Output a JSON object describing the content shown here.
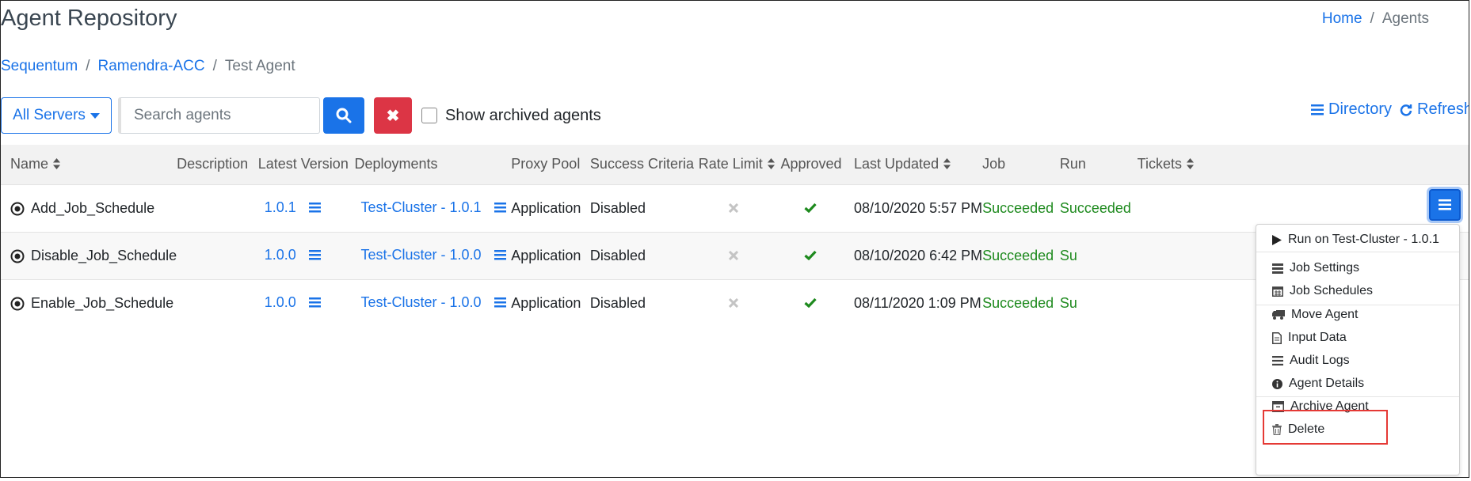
{
  "page": {
    "title": "Agent Repository",
    "top_breadcrumb": {
      "home": "Home",
      "current": "Agents",
      "separator": "/"
    }
  },
  "breadcrumb": {
    "items": [
      "Sequentum",
      "Ramendra-ACC",
      "Test Agent"
    ],
    "separator": "/"
  },
  "toolbar": {
    "servers_label": "All Servers",
    "search_placeholder": "Search agents",
    "show_archived_label": "Show archived agents",
    "directory_label": "Directory",
    "refresh_label": "Refresh"
  },
  "table": {
    "columns": [
      "Name",
      "Description",
      "Latest Version",
      "Deployments",
      "Proxy Pool",
      "Success Criteria",
      "Rate Limit",
      "Approved",
      "Last Updated",
      "Job",
      "Run",
      "Tickets"
    ],
    "rows": [
      {
        "name": "Add_Job_Schedule",
        "description": "",
        "version": "1.0.1",
        "deployment": "Test-Cluster - 1.0.1",
        "proxy_pool": "Application",
        "success_criteria": "Disabled",
        "last_updated": "08/10/2020 5:57 PM",
        "job": "Succeeded",
        "run": "Succeeded"
      },
      {
        "name": "Disable_Job_Schedule",
        "description": "",
        "version": "1.0.0",
        "deployment": "Test-Cluster - 1.0.0",
        "proxy_pool": "Application",
        "success_criteria": "Disabled",
        "last_updated": "08/10/2020 6:42 PM",
        "job": "Succeeded",
        "run": "Su"
      },
      {
        "name": "Enable_Job_Schedule",
        "description": "",
        "version": "1.0.0",
        "deployment": "Test-Cluster - 1.0.0",
        "proxy_pool": "Application",
        "success_criteria": "Disabled",
        "last_updated": "08/11/2020 1:09 PM",
        "job": "Succeeded",
        "run": "Su"
      }
    ]
  },
  "dropdown": {
    "items": [
      "Run on Test-Cluster - 1.0.1",
      "Job Settings",
      "Job Schedules",
      "Move Agent",
      "Input Data",
      "Audit Logs",
      "Agent Details",
      "Archive Agent",
      "Delete"
    ],
    "highlighted": "Archive Agent"
  },
  "colors": {
    "primary": "#1a73e8",
    "danger": "#dc3545",
    "success": "#1e8a1e",
    "highlight_border": "#e53935"
  }
}
